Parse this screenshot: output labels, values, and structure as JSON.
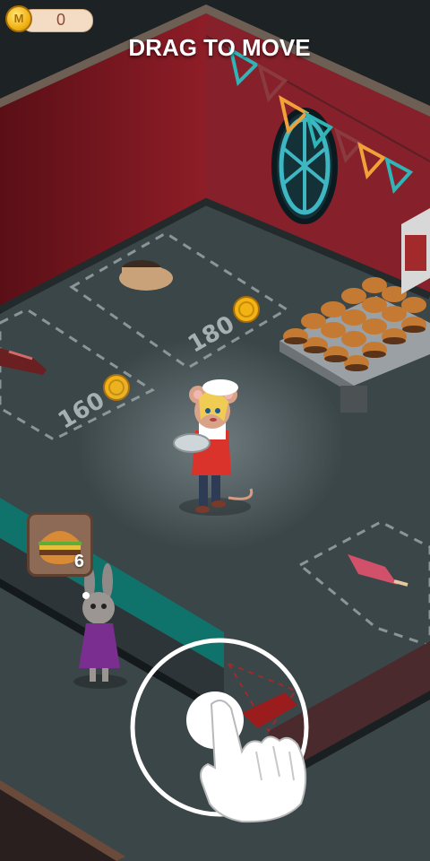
{
  "hud": {
    "coins": "0",
    "coin_icon": "coin-icon",
    "coin_icon_letter": "M"
  },
  "tutorial": {
    "instruction": "DRAG TO MOVE",
    "gesture_icon": "pointing-hand-icon"
  },
  "tables": [
    {
      "item": "coffee-cup",
      "price": "180"
    },
    {
      "item": "soda-bottle",
      "price": "160"
    },
    {
      "item": "popsicle",
      "price": ""
    }
  ],
  "customer_order": {
    "item": "burger-icon",
    "quantity": "6"
  },
  "colors": {
    "wall": "#8b1a24",
    "floor": "#3d484b",
    "counter": "#0f6a63",
    "coin": "#f2b315",
    "apron": "#d9332b"
  }
}
